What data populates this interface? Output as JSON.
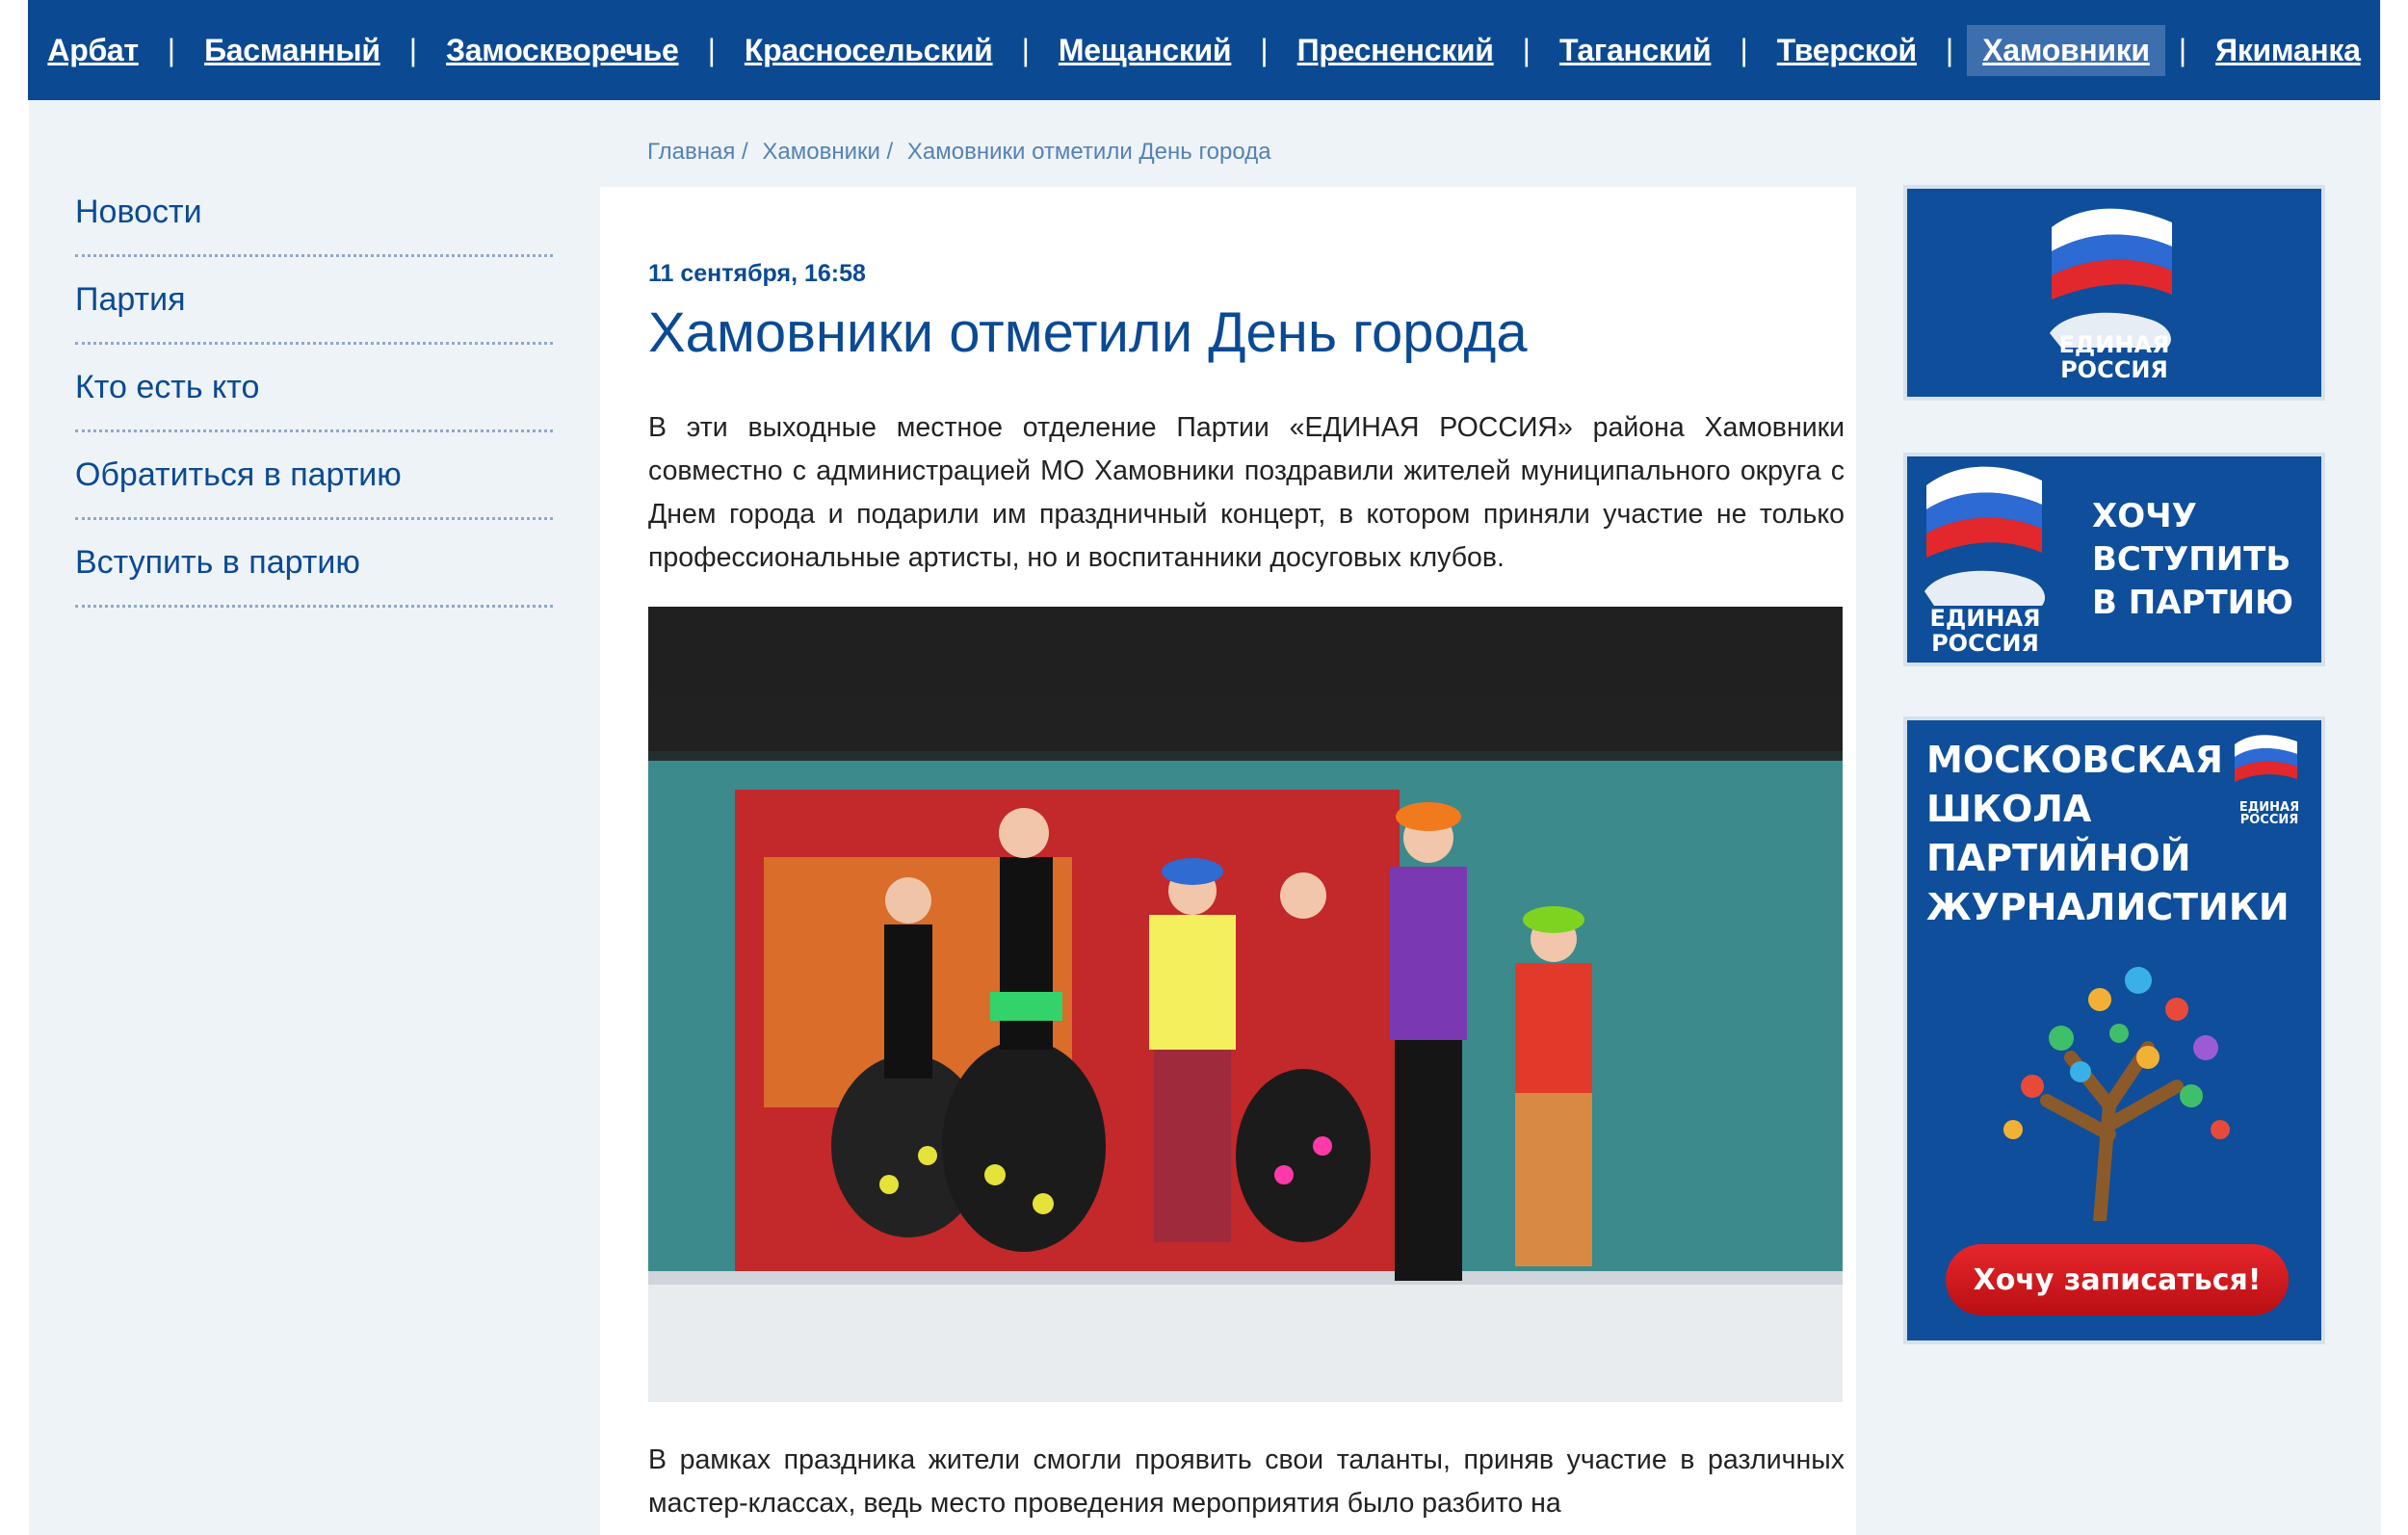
{
  "topnav": {
    "items": [
      "Арбат",
      "Басманный",
      "Замоскворечье",
      "Красносельский",
      "Мещанский",
      "Пресненский",
      "Таганский",
      "Тверской",
      "Хамовники",
      "Якиманка"
    ],
    "active": "Хамовники"
  },
  "leftmenu": {
    "items": [
      "Новости",
      "Партия",
      "Кто есть кто",
      "Обратиться в партию",
      "Вступить в партию"
    ]
  },
  "breadcrumb": {
    "home": "Главная /",
    "section": "Хамовники /",
    "current": "Хамовники отметили День города"
  },
  "article": {
    "date": "11 сентября, 16:58",
    "title": "Хамовники отметили День города",
    "paragraph1": "В эти выходные местное отделение Партии «ЕДИНАЯ РОССИЯ» района Хамовники совместно с администрацией МО Хамовники поздравили жителей муниципального округа с Днем города и подарили им праздничный концерт, в котором приняли участие не только профессиональные артисты, но и воспитанники досуговых клубов.",
    "paragraph2": "В рамках праздника жители смогли проявить свои таланты, приняв участие в различных мастер-классах, ведь место проведения мероприятия было разбито на"
  },
  "banners": {
    "logo_line1": "ЕДИНАЯ",
    "logo_line2": "РОССИЯ",
    "join": [
      "ХОЧУ",
      "ВСТУПИТЬ",
      "В ПАРТИЮ"
    ],
    "school": [
      "МОСКОВСКАЯ",
      "ШКОЛА",
      "ПАРТИЙНОЙ",
      "ЖУРНАЛИСТИКИ"
    ],
    "cta": "Хочу записаться!"
  },
  "colors": {
    "brand": "#0b4a93",
    "banner": "#0e4e9a",
    "cta": "#d6181e"
  }
}
